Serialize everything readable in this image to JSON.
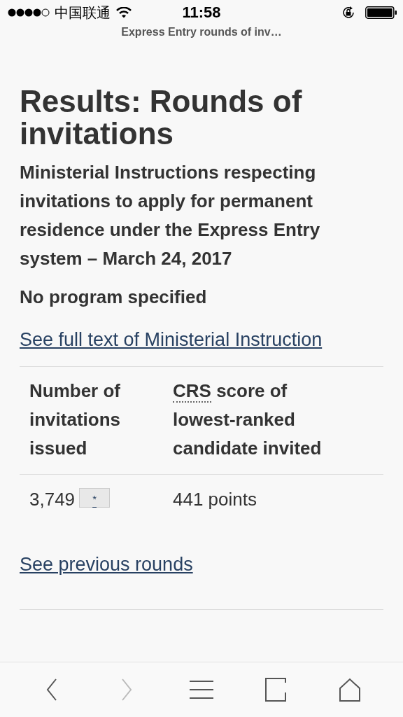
{
  "status_bar": {
    "carrier": "中国联通",
    "time": "11:58"
  },
  "page_title": "Express Entry rounds of inv…",
  "heading": "Results: Rounds of invitations",
  "subheading": "Ministerial Instructions respecting invitations to apply for permanent residence under the Express Entry system – March 24, 2017",
  "program": "No program specified",
  "instruction_link": "See full text of Ministerial Instruction",
  "table": {
    "columns": [
      {
        "text": "Number of invitations issued"
      },
      {
        "abbr": "CRS",
        "text": "score of lowest-ranked candidate invited"
      }
    ],
    "rows": [
      {
        "cells": [
          {
            "text": "3,749",
            "footnote": "*"
          },
          {
            "text": "441 points"
          }
        ]
      }
    ]
  },
  "previous_link": "See previous rounds",
  "toolbar": [
    {
      "kind": "back",
      "disabled": false
    },
    {
      "kind": "forward",
      "disabled": true
    },
    {
      "kind": "menu",
      "disabled": false
    },
    {
      "kind": "tabs",
      "disabled": false
    },
    {
      "kind": "home",
      "disabled": false
    }
  ]
}
